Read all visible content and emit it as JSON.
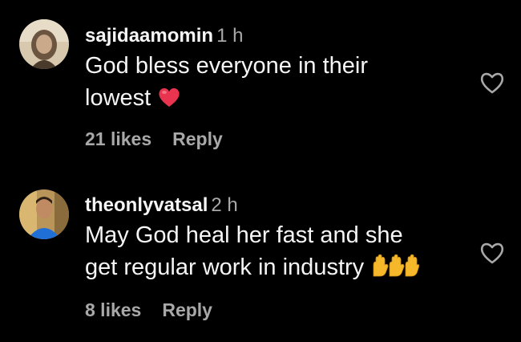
{
  "comments": [
    {
      "username": "sajidaamomin",
      "time": "1 h",
      "text_line1": "God bless everyone in their",
      "text_line2": "lowest",
      "emoji": "red-heart",
      "likes": "21 likes",
      "reply": "Reply",
      "avatar": "profile-photo-woman"
    },
    {
      "username": "theonlyvatsal",
      "time": "2 h",
      "text_line1": "May God heal her fast and she",
      "text_line2": "get regular work in industry",
      "emoji": "raising-hands",
      "likes": "8 likes",
      "reply": "Reply",
      "avatar": "profile-photo-man"
    }
  ],
  "colors": {
    "background": "#000000",
    "primary_text": "#f5f5f5",
    "secondary_text": "#a8a8a8",
    "heart_emoji": "#e8344e",
    "hands_emoji": "#f6b82b"
  }
}
